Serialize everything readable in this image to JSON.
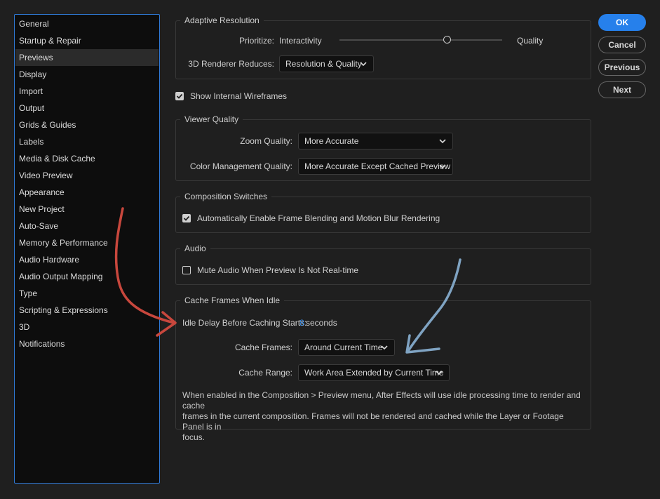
{
  "sidebar": {
    "selected_index": 2,
    "items": [
      {
        "label": "General"
      },
      {
        "label": "Startup & Repair"
      },
      {
        "label": "Previews"
      },
      {
        "label": "Display"
      },
      {
        "label": "Import"
      },
      {
        "label": "Output"
      },
      {
        "label": "Grids & Guides"
      },
      {
        "label": "Labels"
      },
      {
        "label": "Media & Disk Cache"
      },
      {
        "label": "Video Preview"
      },
      {
        "label": "Appearance"
      },
      {
        "label": "New Project"
      },
      {
        "label": "Auto-Save"
      },
      {
        "label": "Memory & Performance"
      },
      {
        "label": "Audio Hardware"
      },
      {
        "label": "Audio Output Mapping"
      },
      {
        "label": "Type"
      },
      {
        "label": "Scripting & Expressions"
      },
      {
        "label": "3D"
      },
      {
        "label": "Notifications"
      }
    ]
  },
  "adaptive_resolution": {
    "title": "Adaptive Resolution",
    "prioritize_label": "Prioritize:",
    "min_label": "Interactivity",
    "max_label": "Quality",
    "slider_value": 0.66,
    "renderer_label": "3D Renderer Reduces:",
    "renderer_value": "Resolution & Quality"
  },
  "show_wireframes": {
    "label": "Show Internal Wireframes",
    "checked": true
  },
  "viewer_quality": {
    "title": "Viewer Quality",
    "zoom_label": "Zoom Quality:",
    "zoom_value": "More Accurate",
    "color_label": "Color Management Quality:",
    "color_value": "More Accurate Except Cached Preview"
  },
  "composition_switches": {
    "title": "Composition Switches",
    "auto_enable_label": "Automatically Enable Frame Blending and Motion Blur Rendering",
    "auto_enable_checked": true
  },
  "audio": {
    "title": "Audio",
    "mute_label": "Mute Audio When Preview Is Not Real-time",
    "mute_checked": false
  },
  "cache_idle": {
    "title": "Cache Frames When Idle",
    "delay_label": "Idle Delay Before Caching Starts:",
    "delay_value": "8",
    "delay_unit": "seconds",
    "frames_label": "Cache Frames:",
    "frames_value": "Around Current Time",
    "range_label": "Cache Range:",
    "range_value": "Work Area Extended by Current Time",
    "desc_lines": [
      "When enabled in the Composition > Preview menu, After Effects will use idle processing time to render and cache",
      "frames in the current composition. Frames will not be rendered and cached while the Layer or Footage Panel is in",
      "focus."
    ]
  },
  "buttons": {
    "ok": "OK",
    "cancel": "Cancel",
    "previous": "Previous",
    "next": "Next"
  },
  "colors": {
    "accent": "#2680eb",
    "annotation_red": "#c8473d",
    "annotation_blue": "#7fa3c2"
  }
}
